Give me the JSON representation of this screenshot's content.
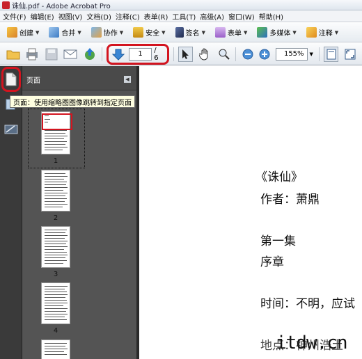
{
  "window": {
    "title": "诛仙.pdf - Adobe Acrobat Pro"
  },
  "menu": [
    "文件(F)",
    "编辑(E)",
    "视图(V)",
    "文档(D)",
    "注释(C)",
    "表单(R)",
    "工具(T)",
    "高级(A)",
    "窗口(W)",
    "帮助(H)"
  ],
  "toolbar": {
    "create": "创建",
    "combine": "合并",
    "collaborate": "协作",
    "secure": "安全",
    "sign": "签名",
    "forms": "表单",
    "multimedia": "多媒体",
    "comment": "注释"
  },
  "nav": {
    "current_page": "1",
    "total_pages": "/ 6",
    "zoom": "155%"
  },
  "panel": {
    "title": "页面"
  },
  "tooltip": "页面：使用缩略图图像跳转到指定页面",
  "thumbnails": [
    {
      "num": "1"
    },
    {
      "num": "2"
    },
    {
      "num": "3"
    },
    {
      "num": "4"
    }
  ],
  "document": {
    "title": "《诛仙》",
    "author": "作者：萧鼎",
    "chapter": "第一集",
    "section": "序章",
    "line1": "时间：不明，应试",
    "line2": "地点：神州浩土"
  },
  "watermark": "itdw.cn",
  "colors": {
    "highlight_ring": "#d3141f",
    "panel_bg": "#545454",
    "rail_bg": "#3a3a3a"
  }
}
